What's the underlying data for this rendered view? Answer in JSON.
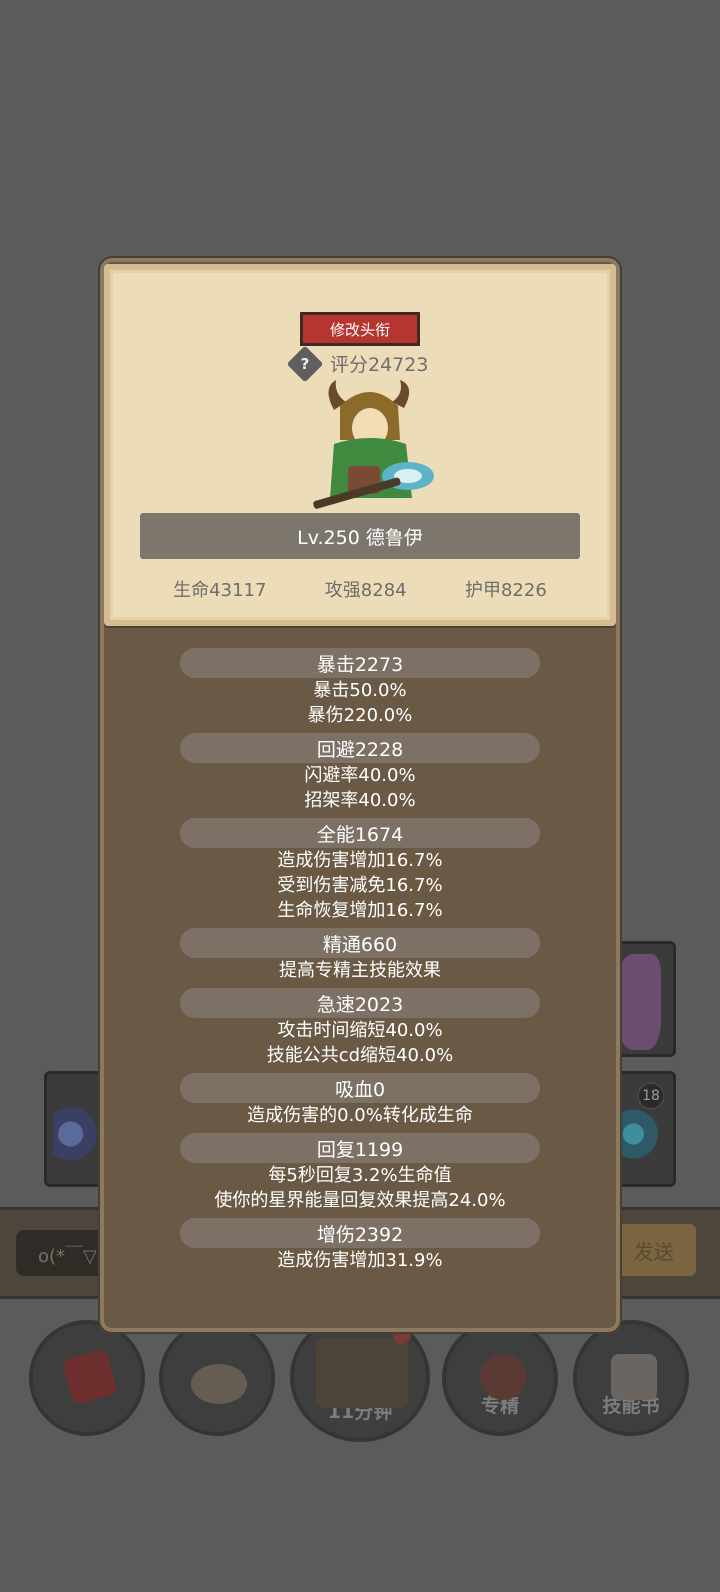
{
  "background": {
    "chat_input": "o(*￣▽",
    "send_label": "发送",
    "card_badge": "18",
    "bottom_buttons": [
      {
        "label": ""
      },
      {
        "label": ""
      },
      {
        "label": "11分钟"
      },
      {
        "label": "专精"
      },
      {
        "label": "技能书"
      }
    ]
  },
  "profile": {
    "title_button": "修改头衔",
    "score_help": "?",
    "score": "评分24723",
    "level_name": "Lv.250 德鲁伊",
    "stats": {
      "hp": "生命43117",
      "attack": "攻强8284",
      "armor": "护甲8226"
    }
  },
  "attributes": [
    {
      "header": "暴击2273",
      "lines": [
        "暴击50.0%",
        "暴伤220.0%"
      ]
    },
    {
      "header": "回避2228",
      "lines": [
        "闪避率40.0%",
        "招架率40.0%"
      ]
    },
    {
      "header": "全能1674",
      "lines": [
        "造成伤害增加16.7%",
        "受到伤害减免16.7%",
        "生命恢复增加16.7%"
      ]
    },
    {
      "header": "精通660",
      "lines": [
        "提高专精主技能效果"
      ]
    },
    {
      "header": "急速2023",
      "lines": [
        "攻击时间缩短40.0%",
        "技能公共cd缩短40.0%"
      ]
    },
    {
      "header": "吸血0",
      "lines": [
        "造成伤害的0.0%转化成生命"
      ]
    },
    {
      "header": "回复1199",
      "lines": [
        "每5秒回复3.2%生命值",
        "使你的星界能量回复效果提高24.0%"
      ]
    },
    {
      "header": "增伤2392",
      "lines": [
        "造成伤害增加31.9%"
      ]
    }
  ]
}
